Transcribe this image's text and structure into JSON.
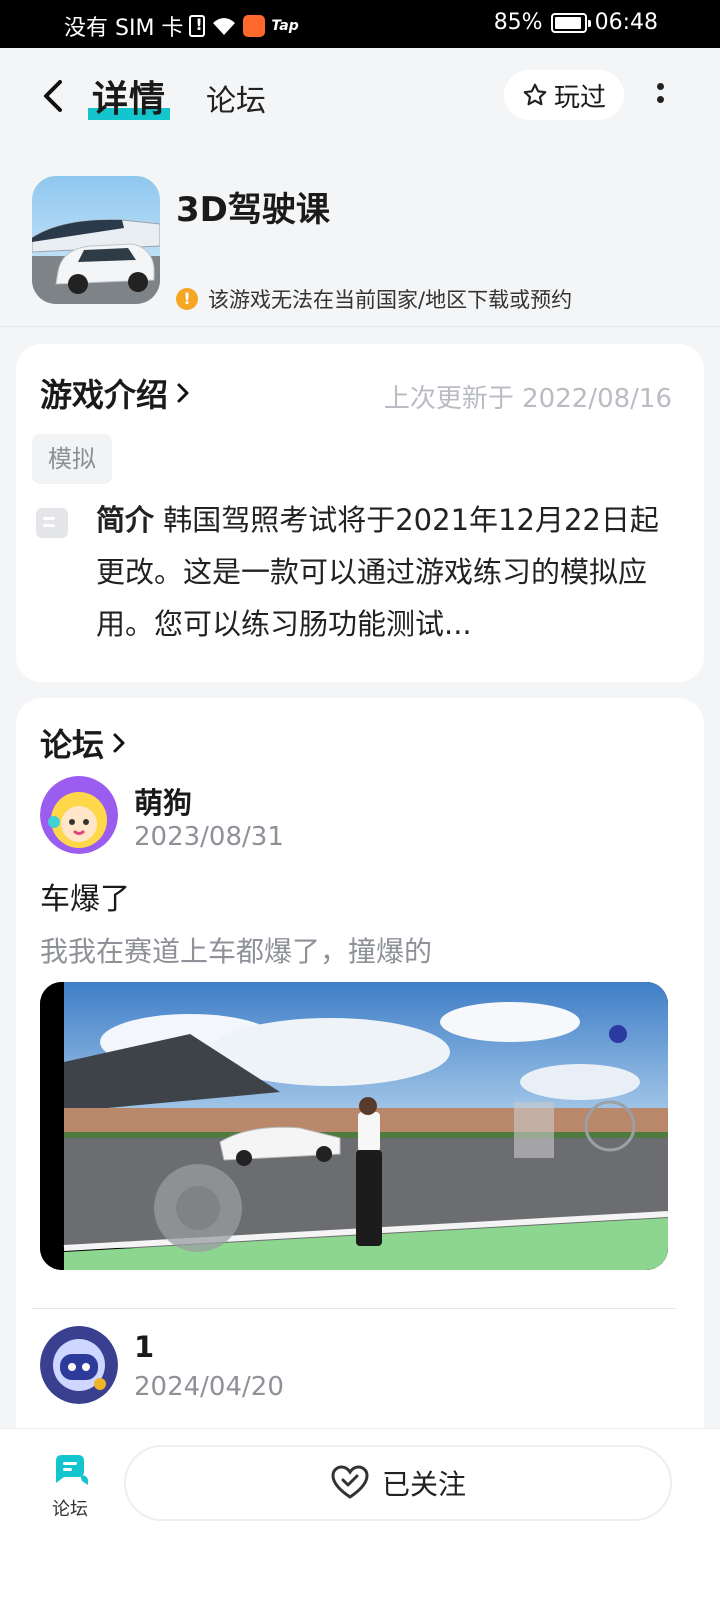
{
  "status_bar": {
    "carrier": "没有 SIM 卡",
    "tap_label": "Tap",
    "battery": "85%",
    "time": "06:48"
  },
  "header": {
    "tabs": [
      {
        "label": "详情",
        "active": true
      },
      {
        "label": "论坛",
        "active": false
      }
    ],
    "played_label": "玩过"
  },
  "game": {
    "title": "3D驾驶课",
    "warning": "该游戏无法在当前国家/地区下载或预约"
  },
  "intro": {
    "title": "游戏介绍",
    "updated": "上次更新于 2022/08/16",
    "tag": "模拟",
    "desc_label": "简介",
    "desc_text": "韩国驾照考试将于2021年12月22日起更改。这是一款可以通过游戏练习的模拟应用。您可以练习肠功能测试..."
  },
  "forum": {
    "title": "论坛",
    "posts": [
      {
        "user": "萌狗",
        "date": "2023/08/31",
        "title": "车爆了",
        "body": "我我在赛道上车都爆了，撞爆的"
      },
      {
        "user": "1",
        "date": "2024/04/20"
      }
    ]
  },
  "bottom": {
    "forum_label": "论坛",
    "follow_label": "已关注"
  },
  "colors": {
    "accent": "#15c5ce",
    "warning": "#f5a623",
    "muted": "#8e9197"
  }
}
